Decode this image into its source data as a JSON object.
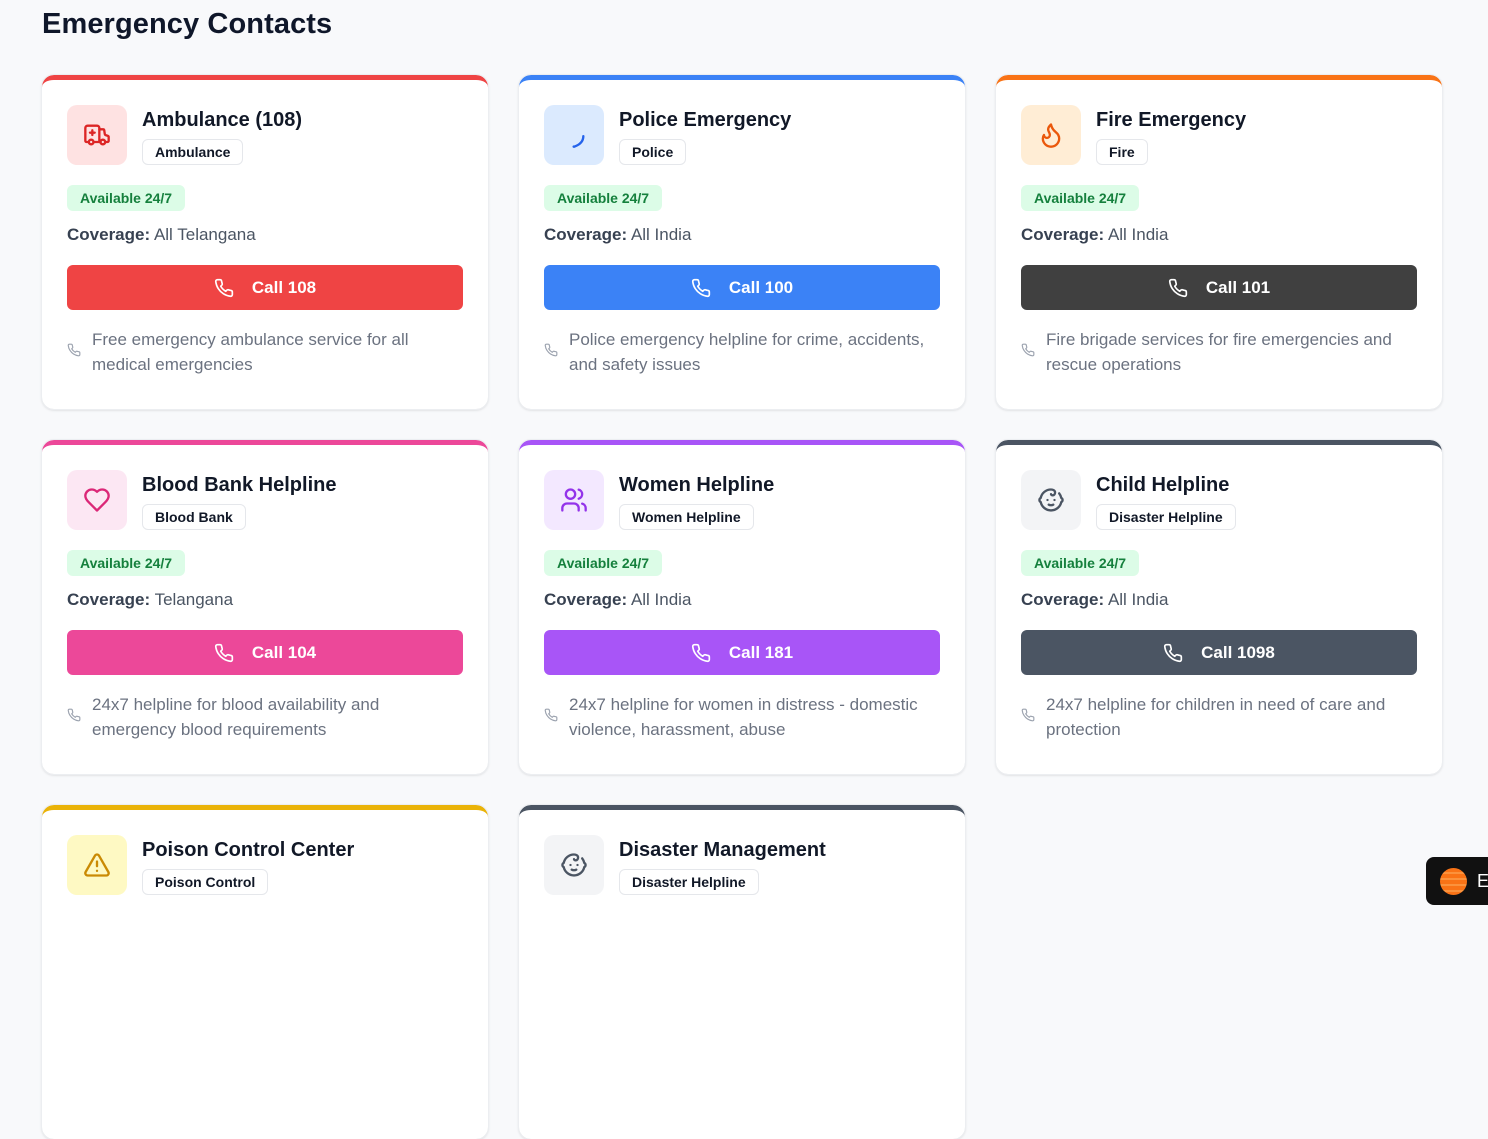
{
  "page": {
    "title": "Emergency Contacts"
  },
  "common": {
    "available": "Available 24/7",
    "coverage_label": "Coverage:"
  },
  "cards": [
    {
      "title": "Ambulance (108)",
      "type": "Ambulance",
      "coverage": "All Telangana",
      "call": "Call 108",
      "description": "Free emergency ambulance service for all medical emergencies",
      "icon": "ambulance-icon",
      "accent": "#ef4444",
      "tint": "#fee2e2",
      "button": "#ef4444",
      "icon_color": "#dc2626"
    },
    {
      "title": "Police Emergency",
      "type": "Police",
      "coverage": "All India",
      "call": "Call 100",
      "description": "Police emergency helpline for crime, accidents, and safety issues",
      "icon": "shield-icon",
      "accent": "#3b82f6",
      "tint": "#dbeafe",
      "button": "#3b82f6",
      "icon_color": "#2563eb"
    },
    {
      "title": "Fire Emergency",
      "type": "Fire",
      "coverage": "All India",
      "call": "Call 101",
      "description": "Fire brigade services for fire emergencies and rescue operations",
      "icon": "flame-icon",
      "accent": "#f97316",
      "tint": "#ffedd5",
      "button": "#404040",
      "icon_color": "#ea580c"
    },
    {
      "title": "Blood Bank Helpline",
      "type": "Blood Bank",
      "coverage": "Telangana",
      "call": "Call 104",
      "description": "24x7 helpline for blood availability and emergency blood requirements",
      "icon": "heart-icon",
      "accent": "#ec4899",
      "tint": "#fce7f3",
      "button": "#ec4899",
      "icon_color": "#db2777"
    },
    {
      "title": "Women Helpline",
      "type": "Women Helpline",
      "coverage": "All India",
      "call": "Call 181",
      "description": "24x7 helpline for women in distress - domestic violence, harassment, abuse",
      "icon": "users-icon",
      "accent": "#a855f7",
      "tint": "#f3e8ff",
      "button": "#a855f7",
      "icon_color": "#9333ea"
    },
    {
      "title": "Child Helpline",
      "type": "Disaster Helpline",
      "coverage": "All India",
      "call": "Call 1098",
      "description": "24x7 helpline for children in need of care and protection",
      "icon": "baby-icon",
      "accent": "#4b5563",
      "tint": "#f3f4f6",
      "button": "#4b5563",
      "icon_color": "#4b5563"
    },
    {
      "title": "Poison Control Center",
      "type": "Poison Control",
      "coverage": "",
      "call": "",
      "description": "",
      "icon": "warning-icon",
      "accent": "#eab308",
      "tint": "#fef9c3",
      "button": "#eab308",
      "icon_color": "#ca8a04"
    },
    {
      "title": "Disaster Management",
      "type": "Disaster Helpline",
      "coverage": "",
      "call": "",
      "description": "",
      "icon": "baby-icon",
      "accent": "#4b5563",
      "tint": "#f3f4f6",
      "button": "#4b5563",
      "icon_color": "#4b5563"
    }
  ],
  "floating_widget": {
    "icon": "sun-logo-icon",
    "label": "E"
  }
}
